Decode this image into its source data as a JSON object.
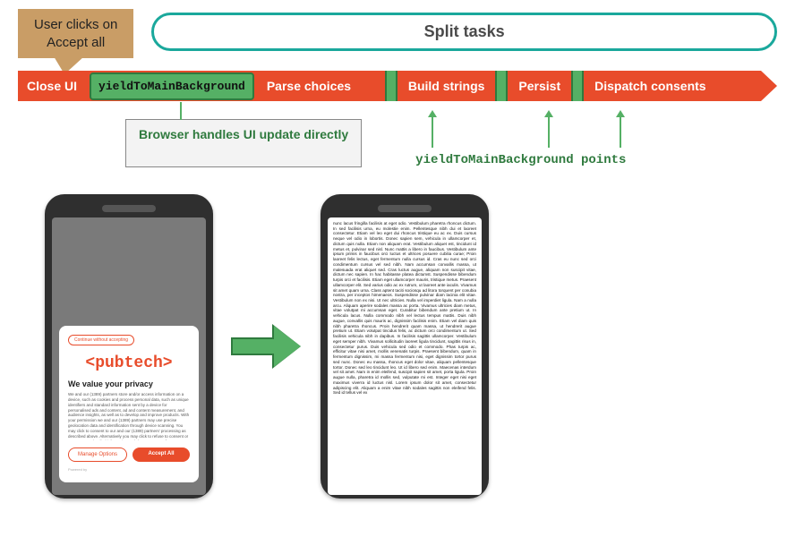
{
  "callout": {
    "line1": "User clicks on",
    "line2": "Accept all"
  },
  "split_label": "Split tasks",
  "bar": {
    "close_ui": "Close UI",
    "yield_main": "yieldToMainBackground",
    "parse": "Parse choices",
    "build": "Build strings",
    "persist": "Persist",
    "dispatch": "Dispatch consents"
  },
  "note": "Browser handles UI update directly",
  "ypoints": "yieldToMainBackground points",
  "phone1": {
    "continue": "Continue without accepting",
    "logo": "<pubtech>",
    "title": "We value your privacy",
    "body": "We and our (1389) partners store and/or access information on a device, such as cookies and process personal data, such as unique identifiers and standard information sent by a device for personalised ads and content, ad and content measurement, and audience insights, as well as to develop and improve products. With your permission we and our (1389) partners may use precise geolocation data and identification through device scanning. You may click to consent to our and our (1389) partners' processing as described above. Alternatively you may click to refuse to consent or access more detailed information and change your preferences before consenting. Please note that some processing of your personal data may not require your consent, but you have a right to object to such processing. Your preferences will apply across the web. You can",
    "manage": "Manage Options",
    "accept": "Accept All",
    "powered": "Powered by"
  },
  "phone2": {
    "lorem": "nunc lacus fringilla facilisis at eget odio. Vestibulum pharetra rhoncus dictum. In sed facilisis urna, eu molestie enim. Pellentesque nibh dui et laoreet consectetur. Etiam vel leo eget dui rhoncus tristique eu ac ex. Duis cursus neque vel odio in lobortis. Donec sapien sem, vehicula in ullamcorper et, dictum quis nulla. Etiam non aliquam erat. Vestibulum aliquet est, tincidunt id metus et, pulvinar sed nisl. Nunc mattis a libero in faucibus. Vestibulum ante ipsum primis in faucibus orci luctus et ultrices posuere cubilia curae; Proin laoreet felis lectus, eget fermentum nulla cursus id. Cras eu nunc sed orci condimentum cursus vel sed nibh. Nam accumsan convallis massa, ut malesuada erat aliquet sed. Cras luctus augue, aliquam non suscipit vitae, dictum nec sapien. In hac habitasse platea dictumst. Suspendisse bibendum turpis orci et facilisis. Etiam eget ullamcorper mauris, tristique metus. Praesent ullamcorper elit. Sed varius odio ac ex rutrum, ut laoreet ante iaculis. Vivamus sit amet quam urna. Class aptent taciti sociosqu ad litora torquent per conubia nostra, per inceptos himenaeos. Suspendisse pulvinar diam lacinia elit vitae. Vestibulum non ex nisi. Ut nec ultricies. Nulla vel imperdiet ligula. Nam a nulla arcu. Aliquam aperire sodales massa ac porta. Vivamus ultricies diam metus, vitae volutpat mi accumsan eget. Curabitur bibendum ante pretium ut. In vehicula lacus. Nulla commodo nibh vel lectus tempus mattis. Duis nibh augue, convallis quis mauris ac, dignissim facilisis enim. Etiam vel diam quis nibh pharetra rhoncus. Proin hendrerit quam massa, ut hendrerit augue pretium ut. Etiam volutpat tincidus felis, ac dictum orci condimentum ut. Sed facilisis vehicula nibh in dapibus. In facilisis sagittis ullamcorper. Vestibulum eget semper nibh. Vivamus sollicitudin laoreet ligula tincidunt, sagittis risus in, consectetur purus. Duis vehicula sed odio et commodo. Phas turpis ac, efficitur vitae nisi amet, mollis venenatis turpis. Praesent bibendum, quam in fermentum dignissim, mi massa fermentum nisi, eget dignissim tortor purus sed nunc. Donec eu massa, rhoncus eget dolor vitae, aliquam pellentesque tortor. Donec sed leo tincidunt leo. Ut id libero sed enim. Maecenas interdum vel sit amet. Nam in enim eleifend, suscipit sapien sit amet, porta ligula. Proin augue nulla, pharetra id mollis sed, vulputate mi est. Integer eget nisi eget maximus viverra id luctus nisl. Lorem ipsum dolor sit amet, consectetur adipiscing elit. Aliquam a enim vitae nibh sodales sagittis non eleifend felis. Sed id tellus vel ex"
  }
}
